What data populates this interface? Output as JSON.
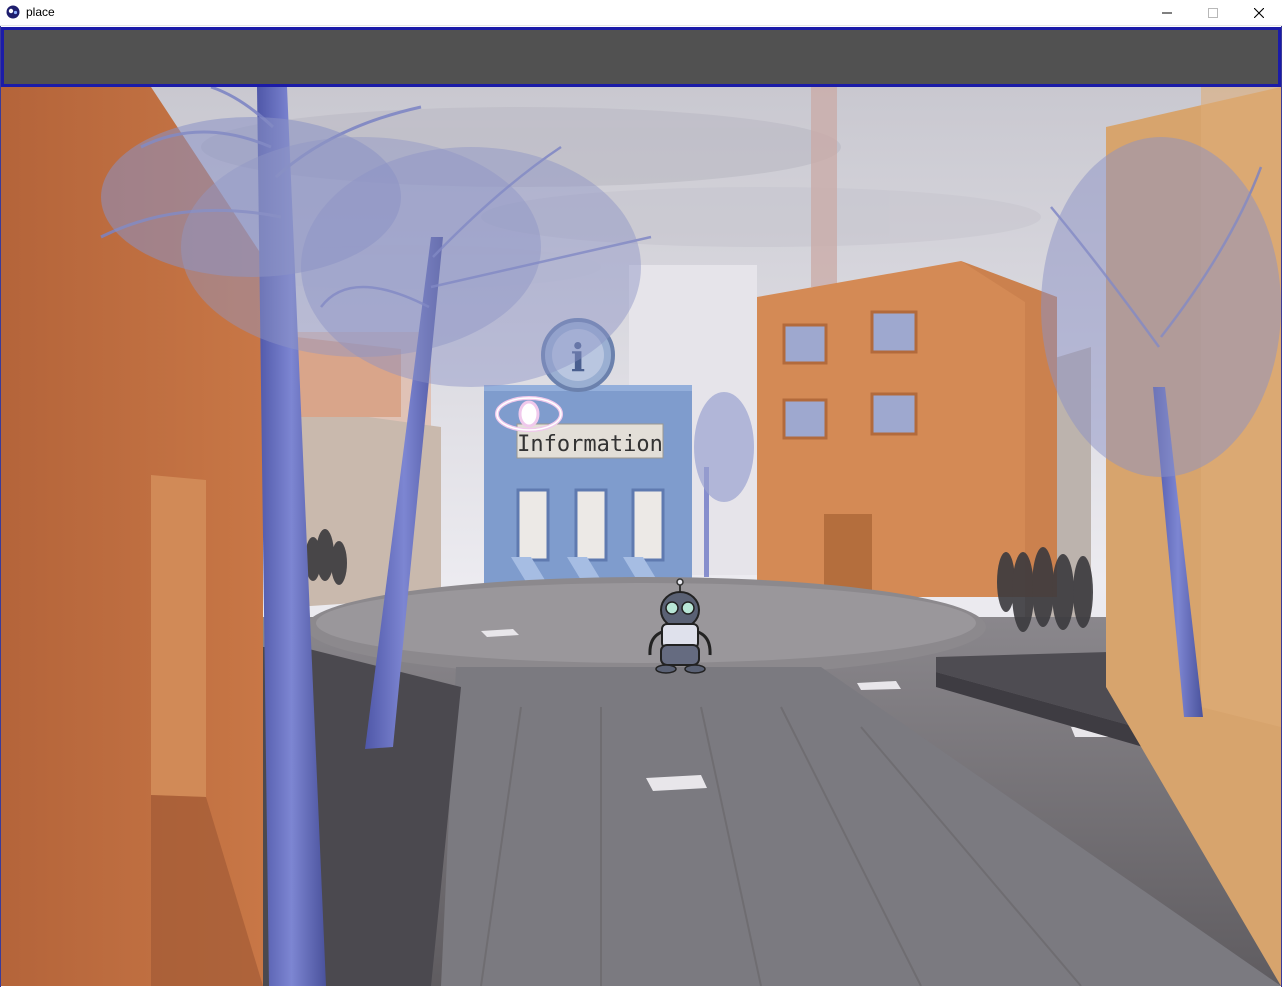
{
  "window": {
    "title": "place",
    "buttons": {
      "minimize": "minimize-icon",
      "maximize": "maximize-icon",
      "close": "close-icon"
    }
  },
  "toolbar": {
    "border_color": "#1b1ba8",
    "background": "#515151"
  },
  "scene": {
    "sign_text": "Information",
    "info_symbol": "i",
    "cursor": "eye-icon",
    "colors": {
      "tree_trunk": "#6f78c6",
      "building_orange": "#d88a52",
      "info_building": "#7f9ccd",
      "road": "#6f6c70",
      "sky": "#e7e6ec"
    }
  }
}
